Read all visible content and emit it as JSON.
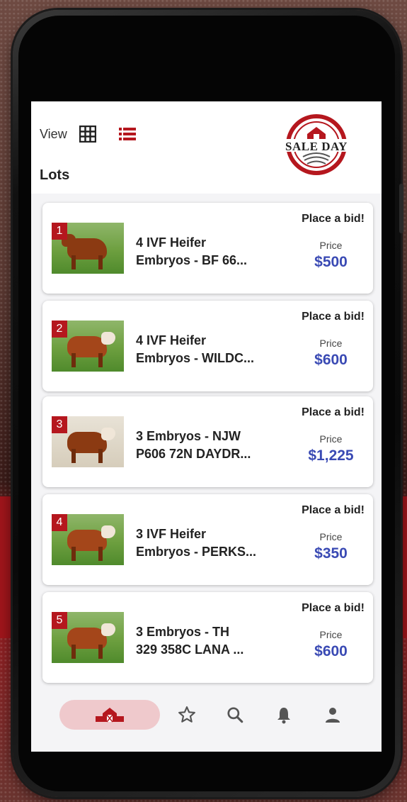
{
  "header": {
    "view_label": "View",
    "lots_title": "Lots",
    "logo_text": "SALE DAY",
    "icons": {
      "grid": "grid-view-icon",
      "list": "list-view-icon"
    }
  },
  "lots": [
    {
      "number": "1",
      "title_line1": "4 IVF Heifer",
      "title_line2": "Embryos - BF 66...",
      "bid_label": "Place a bid!",
      "price_label": "Price",
      "price": "$500"
    },
    {
      "number": "2",
      "title_line1": "4 IVF Heifer",
      "title_line2": "Embryos - WILDC...",
      "bid_label": "Place a bid!",
      "price_label": "Price",
      "price": "$600"
    },
    {
      "number": "3",
      "title_line1": "3 Embryos - NJW",
      "title_line2": "P606 72N DAYDR...",
      "bid_label": "Place a bid!",
      "price_label": "Price",
      "price": "$1,225"
    },
    {
      "number": "4",
      "title_line1": "3 IVF Heifer",
      "title_line2": "Embryos - PERKS...",
      "bid_label": "Place a bid!",
      "price_label": "Price",
      "price": "$350"
    },
    {
      "number": "5",
      "title_line1": "3 Embryos - TH",
      "title_line2": "329 358C LANA ...",
      "bid_label": "Place a bid!",
      "price_label": "Price",
      "price": "$600"
    }
  ],
  "tabbar": {
    "icons": [
      "barn-home-icon",
      "star-icon",
      "search-icon",
      "bell-icon",
      "user-icon"
    ]
  },
  "colors": {
    "brand_red": "#b5171e",
    "price_blue": "#3a4ab4",
    "active_tab_bg": "#efc9cc"
  }
}
